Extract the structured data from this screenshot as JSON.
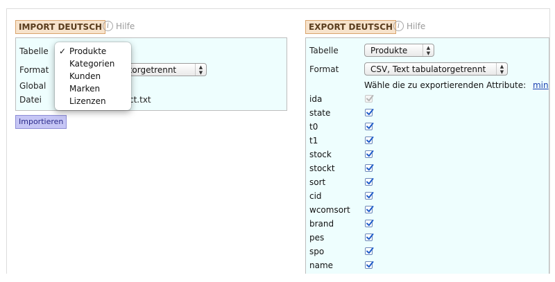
{
  "import": {
    "heading": "IMPORT DEUTSCH",
    "help": "Hilfe",
    "rows": {
      "table_label": "Tabelle",
      "format_label": "Format",
      "global_label": "Global",
      "file_label": "Datei"
    },
    "format_value_partial": "latorgetrennt",
    "file_value_partial": "ct.txt",
    "button": "Importieren",
    "dropdown": {
      "options": [
        "Produkte",
        "Kategorien",
        "Kunden",
        "Marken",
        "Lizenzen"
      ],
      "selected": "Produkte"
    }
  },
  "export": {
    "heading": "EXPORT DEUTSCH",
    "help": "Hilfe",
    "table_label": "Tabelle",
    "table_value": "Produkte",
    "format_label": "Format",
    "format_value": "CSV, Text tabulatorgetrennt",
    "attributes_prompt": "Wähle die zu exportierenden Attribute:",
    "min_link": "min",
    "attributes": [
      {
        "name": "ida",
        "checked": true,
        "disabled": true
      },
      {
        "name": "state",
        "checked": true,
        "disabled": false
      },
      {
        "name": "t0",
        "checked": true,
        "disabled": false
      },
      {
        "name": "t1",
        "checked": true,
        "disabled": false
      },
      {
        "name": "stock",
        "checked": true,
        "disabled": false
      },
      {
        "name": "stockt",
        "checked": true,
        "disabled": false
      },
      {
        "name": "sort",
        "checked": true,
        "disabled": false
      },
      {
        "name": "cid",
        "checked": true,
        "disabled": false
      },
      {
        "name": "wcomsort",
        "checked": true,
        "disabled": false
      },
      {
        "name": "brand",
        "checked": true,
        "disabled": false
      },
      {
        "name": "pes",
        "checked": true,
        "disabled": false
      },
      {
        "name": "spo",
        "checked": true,
        "disabled": false
      },
      {
        "name": "name",
        "checked": true,
        "disabled": false
      }
    ]
  },
  "colors": {
    "panel_bg": "#eefefe",
    "heading_bg": "#f7e3cc",
    "button_bg": "#c6c6f5",
    "checkbox_check": "#1f5cc9"
  }
}
